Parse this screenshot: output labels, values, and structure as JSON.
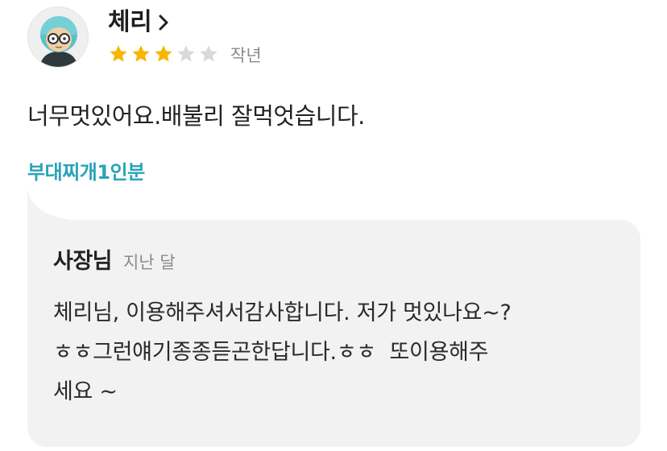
{
  "reviewer": {
    "name": "체리",
    "rating": 3,
    "max_rating": 5,
    "date": "작년"
  },
  "review": {
    "text": "너무멋있어요.배불리 잘먹엇습니다.",
    "menu_tag": "부대찌개1인분"
  },
  "reply": {
    "author": "사장님",
    "date": "지난 달",
    "text": "체리님, 이용해주셔서감사합니다. 저가 멋있나요~?\nㅎㅎ그런얘기종종듣곤한답니다.ㅎㅎ  또이용해주\n세요 ~"
  },
  "colors": {
    "star_filled": "#f7b500",
    "star_empty": "#d9d9d9",
    "menu_tag": "#2aa3b8",
    "reply_bg": "#f2f2f2",
    "muted_text": "#8a8a8a"
  },
  "icons": {
    "avatar": "avatar-helmet-glasses-icon",
    "name_chevron": "chevron-right-icon",
    "rating": "star-icon"
  }
}
